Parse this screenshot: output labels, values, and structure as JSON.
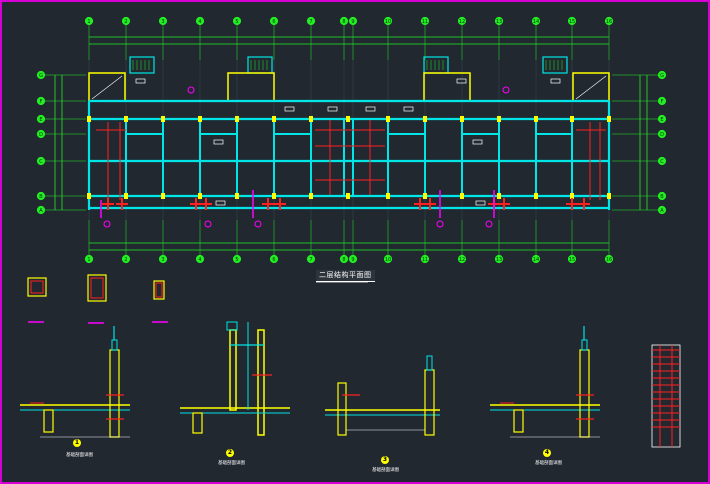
{
  "plan": {
    "title": "二层结构平面图",
    "top_axes": [
      "1",
      "2",
      "3",
      "4",
      "5",
      "6",
      "7",
      "8",
      "9",
      "10",
      "11",
      "12",
      "13",
      "14",
      "15",
      "16"
    ],
    "bottom_axes": [
      "1",
      "2",
      "3",
      "4",
      "5",
      "6",
      "7",
      "8",
      "9",
      "10",
      "11",
      "12",
      "13",
      "14",
      "15",
      "16"
    ],
    "left_axes": [
      "G",
      "F",
      "E",
      "D",
      "C",
      "B",
      "A"
    ],
    "right_axes": [
      "G",
      "F",
      "E",
      "D",
      "C",
      "B",
      "A"
    ]
  },
  "sections": [
    {
      "num": "1",
      "caption": "基础剖面详图"
    },
    {
      "num": "2",
      "caption": "基础剖面详图"
    },
    {
      "num": "3",
      "caption": "基础剖面详图"
    },
    {
      "num": "4",
      "caption": "基础剖面详图"
    }
  ],
  "colors": {
    "background": "#212830",
    "frame": "#d400d4",
    "wall": "#00e5e5",
    "axis": "#22ee22",
    "column": "#ffff00",
    "rebar": "#ff2020",
    "marker": "#ff00ff"
  }
}
